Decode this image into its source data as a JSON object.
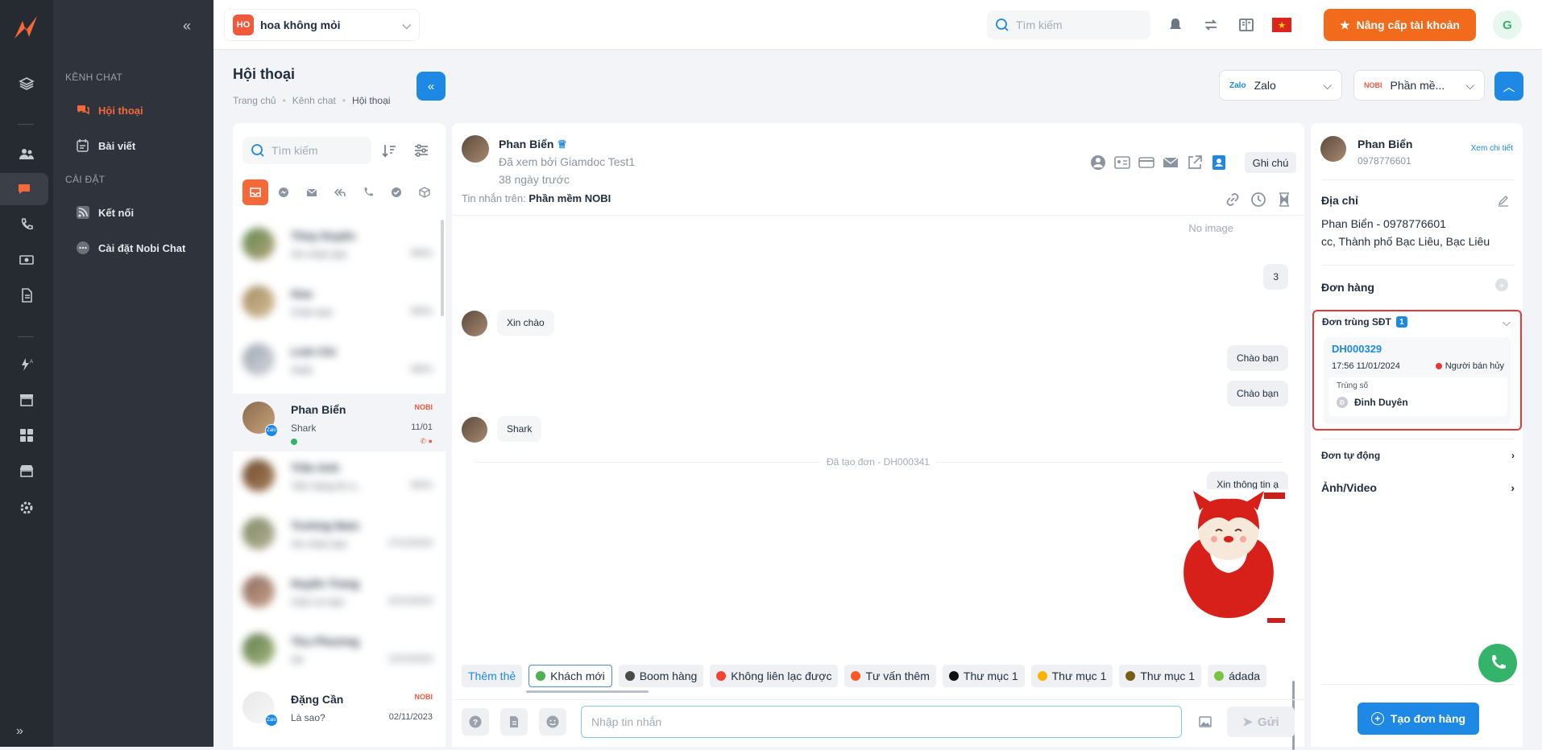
{
  "topbar": {
    "shop_badge": "HO",
    "shop_name": "hoa không mỏi",
    "search_placeholder": "Tìm kiếm",
    "upgrade_label": "Nâng cấp tài khoản",
    "user_initial": "G"
  },
  "subnav": {
    "group_chat": "KÊNH CHAT",
    "items_chat": [
      {
        "label": "Hội thoại",
        "active": true
      },
      {
        "label": "Bài viết",
        "active": false
      }
    ],
    "group_settings": "CÀI ĐẶT",
    "items_settings": [
      {
        "label": "Kết nối"
      },
      {
        "label": "Cài đặt Nobi Chat"
      }
    ]
  },
  "page": {
    "title": "Hội thoại",
    "breadcrumb": [
      "Trang chủ",
      "Kênh chat",
      "Hội thoại"
    ],
    "channel_select": "Zalo",
    "channel_logo": "Zalo",
    "account_select": "Phần mề...",
    "account_logo": "NOBI"
  },
  "list": {
    "search_placeholder": "Tìm kiếm",
    "conversations": [
      {
        "name": "Thùy Duyên",
        "msg": "Xin chào bạn",
        "date": "09/01",
        "blurred": true
      },
      {
        "name": "Hoa",
        "msg": "Chào bạn",
        "date": "09/01",
        "blurred": true
      },
      {
        "name": "Linh Chi",
        "msg": "Hello",
        "date": "08/01",
        "blurred": true
      },
      {
        "name": "Phan Biển",
        "msg": "Shark",
        "date": "11/01",
        "source": "NOBI",
        "zalo": "Zalo",
        "blurred": false
      },
      {
        "name": "Trần Anh",
        "msg": "Tiền hàng thì ạ...",
        "date": "06/01",
        "blurred": true
      },
      {
        "name": "Trường Nam",
        "msg": "Xin chào bạn",
        "date": "27/12/2023",
        "blurred": true
      },
      {
        "name": "Huyền Trang",
        "msg": "Cảm ơn bạn",
        "date": "22/12/2023",
        "blurred": true
      },
      {
        "name": "Thu Phương",
        "msg": "Ok",
        "date": "12/12/2023",
        "blurred": true
      },
      {
        "name": "Đặng Cần",
        "msg": "Là sao?",
        "date": "02/11/2023",
        "source": "NOBI",
        "zalo": "Zalo",
        "blurred": false
      }
    ]
  },
  "chat": {
    "name": "Phan Biển",
    "seen_by": "Đã xem bởi Giamdoc Test1",
    "ago": "38 ngày trước",
    "from_label": "Tin nhắn trên:",
    "from_value": "Phần mềm NOBI",
    "note_label": "Ghi chú",
    "no_image": "No image",
    "messages": [
      {
        "dir": "out",
        "text": "3"
      },
      {
        "dir": "in",
        "text": "Xin chào"
      },
      {
        "dir": "out",
        "text": "Chào bạn"
      },
      {
        "dir": "out",
        "text": "Chào bạn"
      },
      {
        "dir": "in",
        "text": "Shark"
      },
      {
        "dir": "sys",
        "text": "Đã tạo đơn - DH000341"
      },
      {
        "dir": "out",
        "text": "Xin thông tin ạ"
      }
    ],
    "add_tag_label": "Thêm thẻ",
    "tags": [
      {
        "label": "Khách mới",
        "color": "#4caf50",
        "active": true
      },
      {
        "label": "Boom hàng",
        "color": "#4a4a4a"
      },
      {
        "label": "Không liên lạc được",
        "color": "#f44336"
      },
      {
        "label": "Tư vấn thêm",
        "color": "#ff5722"
      },
      {
        "label": "Thư mục 1",
        "color": "#111111"
      },
      {
        "label": "Thư mục 1",
        "color": "#ffb300"
      },
      {
        "label": "Thư mục 1",
        "color": "#7a5c12"
      },
      {
        "label": "ádada",
        "color": "#7cc242"
      }
    ],
    "input_placeholder": "Nhập tin nhắn",
    "send_label": "Gửi"
  },
  "side": {
    "name": "Phan Biển",
    "phone": "0978776601",
    "detail_link": "Xem chi tiết",
    "address_title": "Địa chỉ",
    "address_lines": [
      "Phan Biển - 0978776601",
      "cc, Thành phố Bạc Liêu, Bạc Liêu"
    ],
    "orders_title": "Đơn hàng",
    "dup_title": "Đơn trùng SĐT",
    "dup_count": "1",
    "dup_order_code": "DH000329",
    "dup_order_time": "17:56 11/01/2024",
    "dup_order_status": "Người bán hủy",
    "dup_match_label": "Trùng số",
    "dup_seller_initial": "Đ",
    "dup_seller": "Đinh Duyên",
    "auto_orders": "Đơn tự động",
    "media": "Ảnh/Video",
    "create_order": "Tạo đơn hàng"
  },
  "colors": {
    "accent": "#1e88e5",
    "brand": "#f4683a",
    "upgrade": "#f26a1b",
    "danger": "#e53935"
  }
}
